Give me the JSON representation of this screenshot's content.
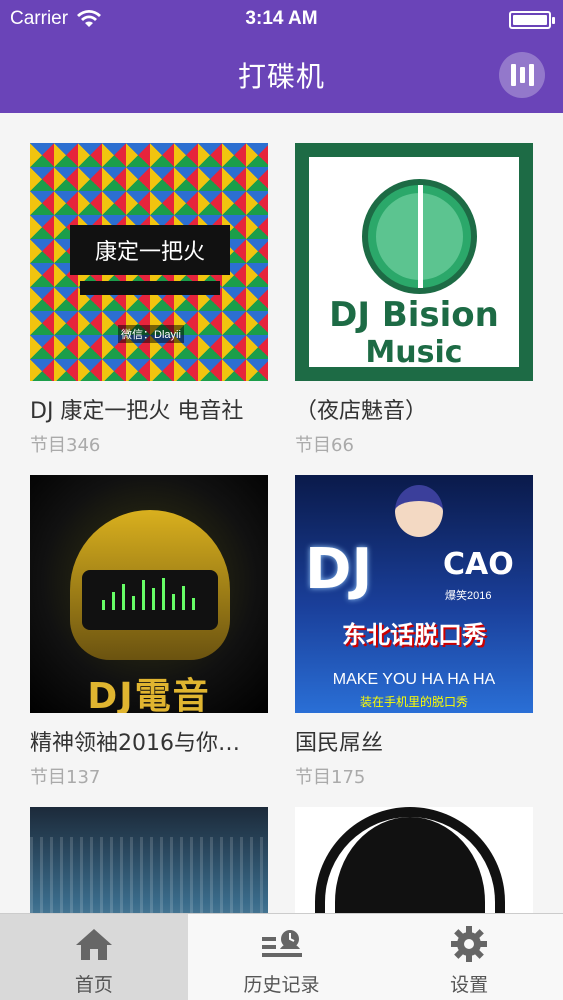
{
  "status_bar": {
    "carrier": "Carrier",
    "time": "3:14 AM"
  },
  "nav": {
    "title": "打碟机",
    "right_icon": "equalizer-icon"
  },
  "accent_color": "#6a44b8",
  "albums": [
    {
      "name": "DJ 康定一把火 电音社",
      "count": "节目346",
      "cover_text": "康定一把火",
      "cover_subtext": "微信：Dlayii"
    },
    {
      "name": "（夜店魅音）",
      "count": "节目66",
      "cover_text": "DJ Bision",
      "cover_subtext": "Music"
    },
    {
      "name": "精神领袖2016与你…",
      "count": "节目137",
      "cover_text": "DJ電音"
    },
    {
      "name": "国民屌丝",
      "count": "节目175",
      "cover_text": "DJ",
      "cover_subtext": "CAO",
      "cover_year": "爆笑2016",
      "cover_title": "东北话脱口秀",
      "cover_en": "MAKE YOU HA HA HA",
      "cover_tag": "装在手机里的脱口秀"
    }
  ],
  "tabs": [
    {
      "label": "首页",
      "icon": "home-icon",
      "active": true
    },
    {
      "label": "历史记录",
      "icon": "history-icon",
      "active": false
    },
    {
      "label": "设置",
      "icon": "gear-icon",
      "active": false
    }
  ]
}
